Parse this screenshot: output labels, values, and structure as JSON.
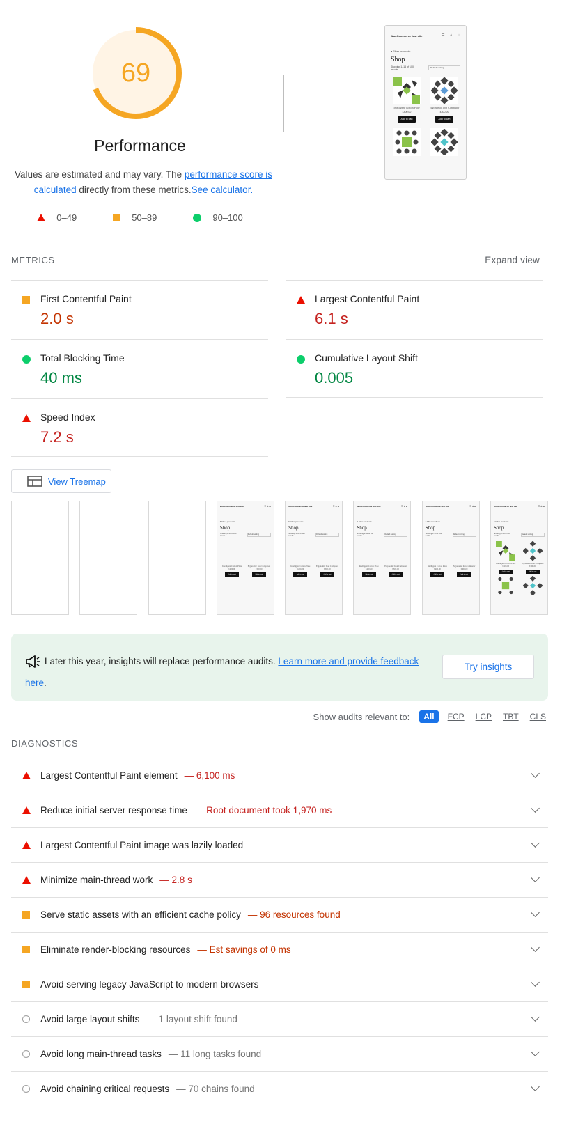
{
  "score": {
    "value": "69",
    "fraction": 0.69,
    "color": "#f5a623",
    "bg": "#fff4e5"
  },
  "performance": {
    "title": "Performance",
    "desc_pre": "Values are estimated and may vary. The ",
    "desc_link1": "performance score is calculated",
    "desc_mid": " directly from these metrics.",
    "desc_link2": "See calculator."
  },
  "legend": [
    {
      "shape": "triangle",
      "label": "0–49",
      "color": "#eb0f00"
    },
    {
      "shape": "square",
      "label": "50–89",
      "color": "#f5a623"
    },
    {
      "shape": "circle",
      "label": "90–100",
      "color": "#0cce6b"
    }
  ],
  "final_screenshot": {
    "site_title": "WooCommerce test site",
    "filter": "Filter products",
    "shop": "Shop",
    "results": "Showing 1–16 of 100 results",
    "sort": "Default sorting",
    "products": [
      {
        "name": "Intelligent Cotton Plate",
        "price": "£400.00",
        "button": "Add to cart"
      },
      {
        "name": "Ergonomic Iron Computer",
        "price": "£300.00",
        "button": "Add to cart"
      }
    ]
  },
  "metrics": {
    "header": "METRICS",
    "expand": "Expand view",
    "items": [
      {
        "label": "First Contentful Paint",
        "value": "2.0 s",
        "status": "orange"
      },
      {
        "label": "Largest Contentful Paint",
        "value": "6.1 s",
        "status": "red"
      },
      {
        "label": "Total Blocking Time",
        "value": "40 ms",
        "status": "green"
      },
      {
        "label": "Cumulative Layout Shift",
        "value": "0.005",
        "status": "green"
      },
      {
        "label": "Speed Index",
        "value": "7.2 s",
        "status": "red"
      }
    ]
  },
  "treemap": {
    "label": "View Treemap"
  },
  "filmstrip": {
    "site_title": "WooCommerce test site",
    "filter": "Filter products",
    "shop": "Shop",
    "results": "Showing 1–16 of 100 results",
    "sort": "Default sorting",
    "p1": "Intelligent Cotton Plate",
    "p2": "Ergonomic Iron Computer",
    "price1": "£400.00",
    "price2": "£300.00",
    "btn": "Add to cart"
  },
  "insights": {
    "text": "Later this year, insights will replace performance audits. ",
    "link": "Learn more and provide feedback here",
    "end": ".",
    "button": "Try insights"
  },
  "filter": {
    "label": "Show audits relevant to:",
    "chips": [
      "All",
      "FCP",
      "LCP",
      "TBT",
      "CLS"
    ]
  },
  "diagnostics": {
    "header": "DIAGNOSTICS",
    "items": [
      {
        "title": "Largest Contentful Paint element",
        "detail": "— 6,100 ms",
        "status": "red"
      },
      {
        "title": "Reduce initial server response time",
        "detail": "— Root document took 1,970 ms",
        "status": "red"
      },
      {
        "title": "Largest Contentful Paint image was lazily loaded",
        "detail": "",
        "status": "red"
      },
      {
        "title": "Minimize main-thread work",
        "detail": "— 2.8 s",
        "status": "red"
      },
      {
        "title": "Serve static assets with an efficient cache policy",
        "detail": "— 96 resources found",
        "status": "orange"
      },
      {
        "title": "Eliminate render-blocking resources",
        "detail": "— Est savings of 0 ms",
        "status": "orange"
      },
      {
        "title": "Avoid serving legacy JavaScript to modern browsers",
        "detail": "",
        "status": "orange"
      },
      {
        "title": "Avoid large layout shifts",
        "detail": "— 1 layout shift found",
        "status": "info"
      },
      {
        "title": "Avoid long main-thread tasks",
        "detail": "— 11 long tasks found",
        "status": "info"
      },
      {
        "title": "Avoid chaining critical requests",
        "detail": "— 70 chains found",
        "status": "info"
      }
    ]
  }
}
